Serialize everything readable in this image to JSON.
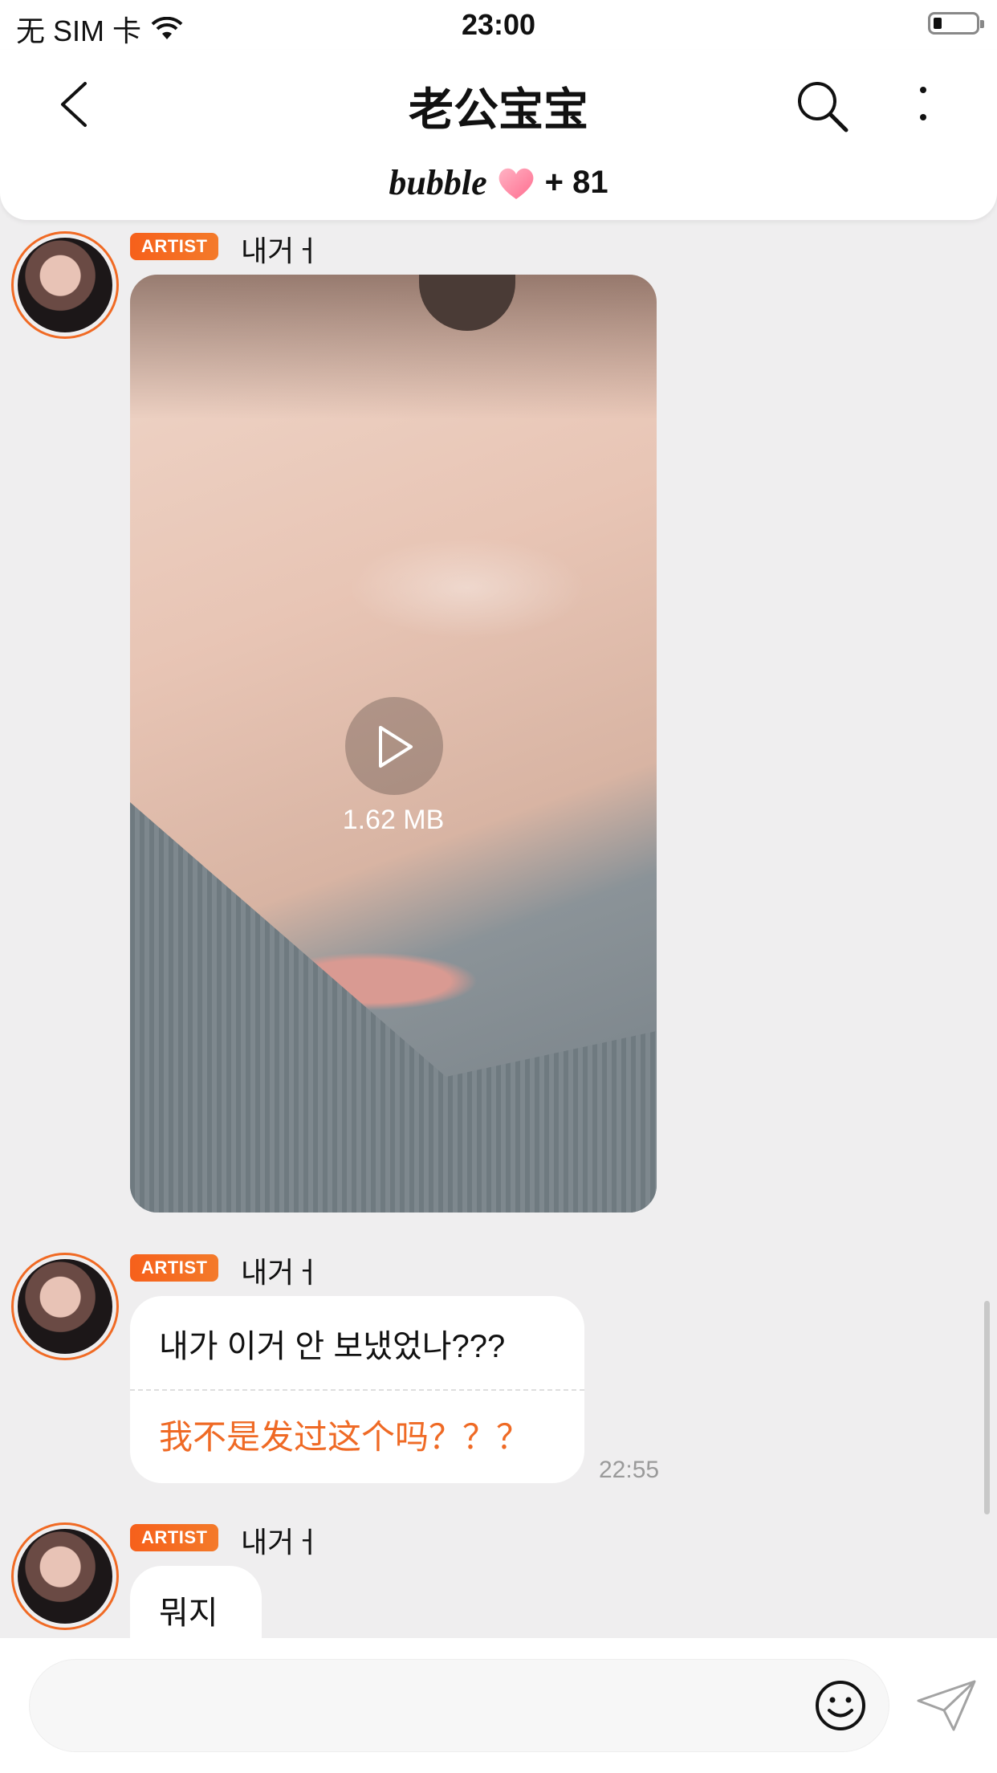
{
  "status_bar": {
    "carrier": "无 SIM 卡",
    "time": "23:00"
  },
  "header": {
    "title": "老公宝宝",
    "bubble_brand": "bubble",
    "count": "+ 81"
  },
  "messages": [
    {
      "badge": "ARTIST",
      "sender": "내거ㅓ",
      "type": "video",
      "size": "1.62 MB"
    },
    {
      "badge": "ARTIST",
      "sender": "내거ㅓ",
      "type": "text",
      "text": "내가 이거 안 보냈었나???",
      "translation": "我不是发过这个吗？？？",
      "time": "22:55"
    },
    {
      "badge": "ARTIST",
      "sender": "내거ㅓ",
      "type": "text",
      "text": "뭐지"
    }
  ],
  "composer": {
    "placeholder": ""
  },
  "colors": {
    "accent": "#f06a24",
    "background": "#efeeef"
  }
}
